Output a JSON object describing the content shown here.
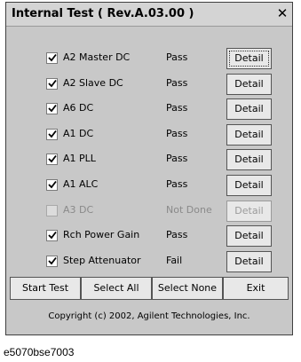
{
  "window": {
    "title": "Internal Test ( Rev.A.03.00 )",
    "close_glyph": "✕"
  },
  "tests": [
    {
      "name": "A2 Master DC",
      "status": "Pass",
      "checked": true,
      "enabled": true,
      "detail_label": "Detail"
    },
    {
      "name": "A2 Slave DC",
      "status": "Pass",
      "checked": true,
      "enabled": true,
      "detail_label": "Detail"
    },
    {
      "name": "A6 DC",
      "status": "Pass",
      "checked": true,
      "enabled": true,
      "detail_label": "Detail"
    },
    {
      "name": "A1 DC",
      "status": "Pass",
      "checked": true,
      "enabled": true,
      "detail_label": "Detail"
    },
    {
      "name": "A1 PLL",
      "status": "Pass",
      "checked": true,
      "enabled": true,
      "detail_label": "Detail"
    },
    {
      "name": "A1 ALC",
      "status": "Pass",
      "checked": true,
      "enabled": true,
      "detail_label": "Detail"
    },
    {
      "name": "A3 DC",
      "status": "Not Done",
      "checked": false,
      "enabled": false,
      "detail_label": "Detail"
    },
    {
      "name": "Rch Power Gain",
      "status": "Pass",
      "checked": true,
      "enabled": true,
      "detail_label": "Detail"
    },
    {
      "name": "Step Attenuator",
      "status": "Fail",
      "checked": true,
      "enabled": true,
      "detail_label": "Detail"
    }
  ],
  "buttons": {
    "start_test": "Start Test",
    "select_all": "Select All",
    "select_none": "Select None",
    "exit": "Exit"
  },
  "copyright": "Copyright (c) 2002, Agilent Technologies, Inc.",
  "caption": "e5070bse7003"
}
